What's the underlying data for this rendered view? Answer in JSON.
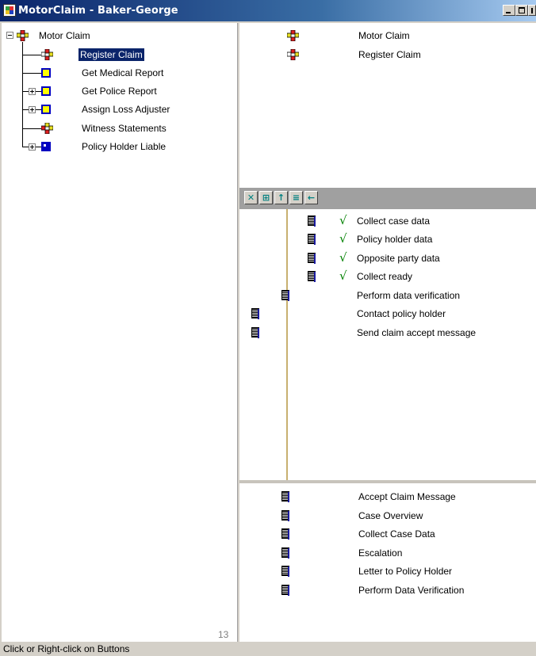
{
  "window": {
    "title": "MotorClaim  - Baker-George"
  },
  "tree": {
    "root": "Motor Claim",
    "items": [
      {
        "label": "Register Claim",
        "icon": "workflow-icon",
        "expandable": false,
        "selected": true
      },
      {
        "label": "Get Medical Report",
        "icon": "yellow-square-icon",
        "expandable": false
      },
      {
        "label": "Get Police Report",
        "icon": "yellow-square-icon",
        "expandable": true
      },
      {
        "label": "Assign Loss Adjuster",
        "icon": "yellow-square-icon",
        "expandable": true
      },
      {
        "label": "Witness Statements",
        "icon": "workflow-icon",
        "expandable": false
      },
      {
        "label": "Policy Holder Liable",
        "icon": "blue-square-icon",
        "expandable": true
      }
    ],
    "count": "13"
  },
  "path_list": {
    "items": [
      "Motor Claim",
      "Register Claim"
    ]
  },
  "toolbar": {
    "buttons": [
      "cross-icon",
      "tree-icon",
      "up-arrow-icon",
      "list-icon",
      "back-arrow-icon"
    ]
  },
  "steps": {
    "items": [
      {
        "label": "Collect case data",
        "done": true
      },
      {
        "label": "Policy holder data",
        "done": true
      },
      {
        "label": "Opposite party data",
        "done": true
      },
      {
        "label": "Collect ready",
        "done": true
      },
      {
        "label": "Perform data verification",
        "done": false
      },
      {
        "label": "Contact policy holder",
        "done": false
      },
      {
        "label": "Send claim accept message",
        "done": false
      }
    ],
    "check_glyph": "√"
  },
  "forms": {
    "items": [
      "Accept Claim Message",
      "Case Overview",
      "Collect Case Data",
      "Escalation",
      "Letter to Policy Holder",
      "Perform Data Verification"
    ]
  },
  "status": {
    "text": "Click or Right-click on Buttons"
  },
  "colors": {
    "selection": "#0a246a",
    "check": "#008000",
    "title_bar": "#0a246a"
  }
}
